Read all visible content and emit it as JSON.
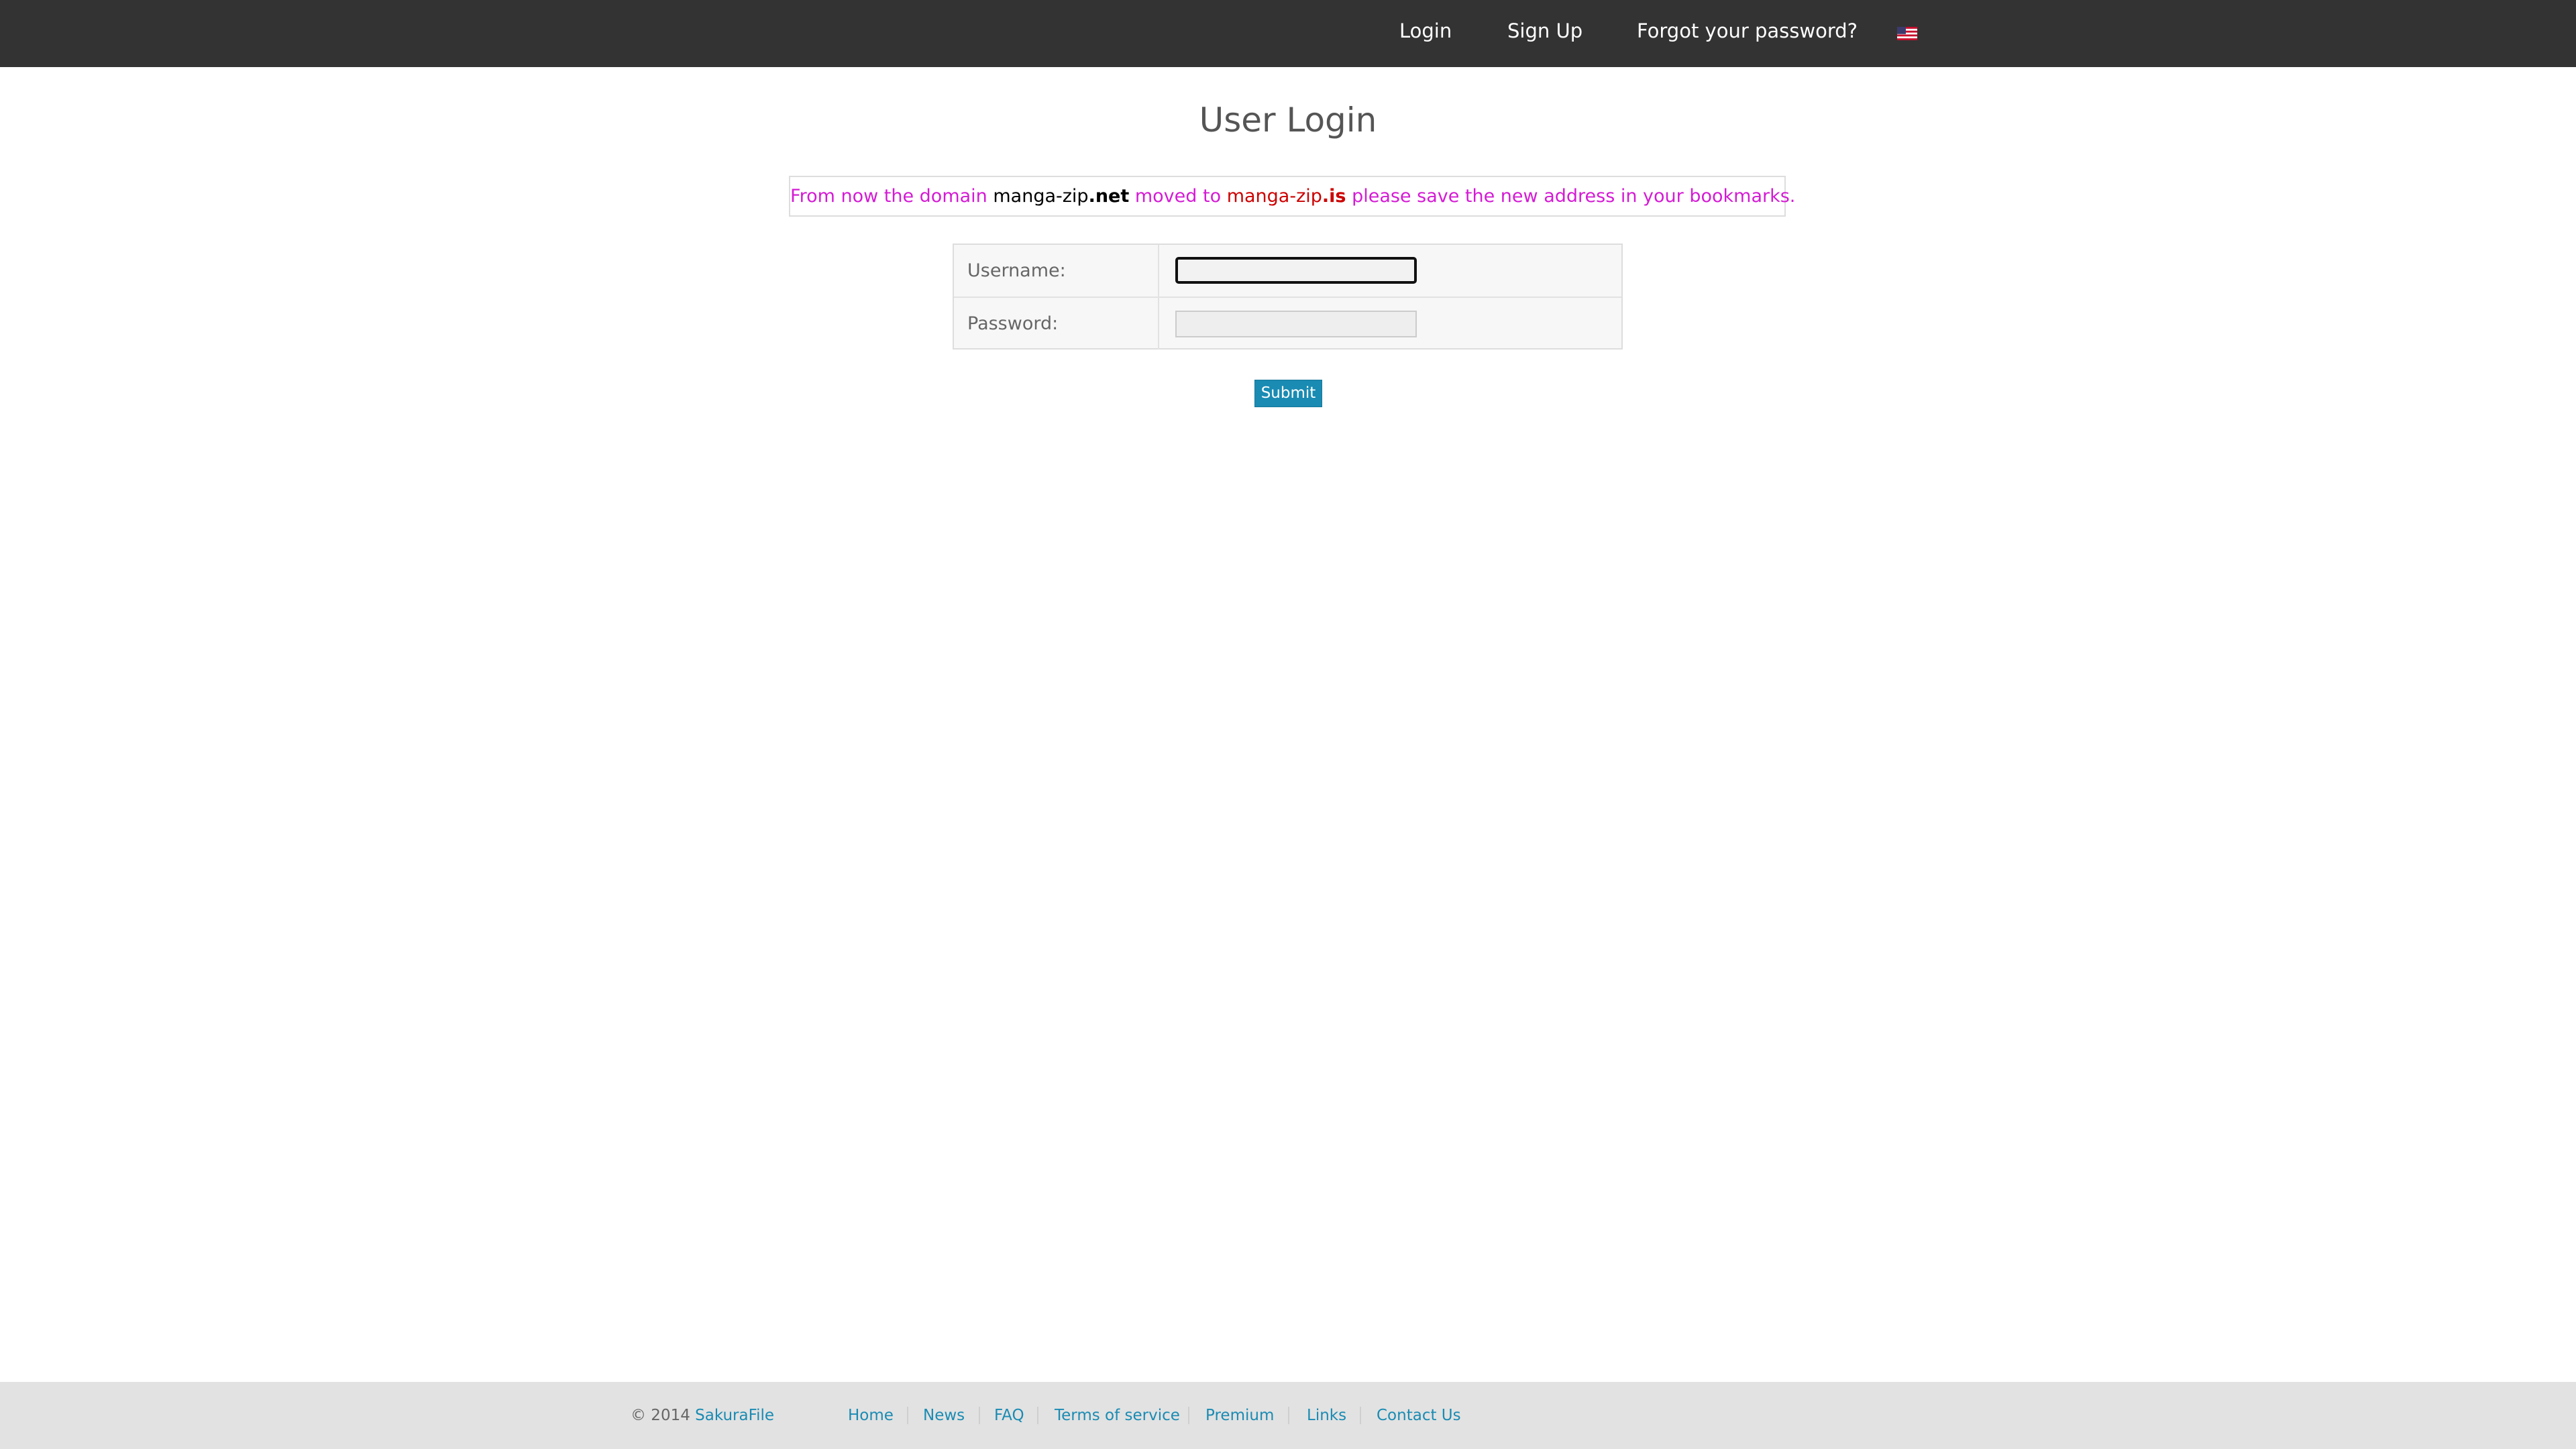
{
  "nav": {
    "login": "Login",
    "signup": "Sign Up",
    "forgot": "Forgot your password?",
    "language_icon": "us-flag-icon"
  },
  "page": {
    "title": "User Login"
  },
  "notice": {
    "part1": "From now the domain ",
    "old_domain_name": "manga-zip",
    "old_domain_tld": ".net",
    "part2": " moved to ",
    "new_domain_name": "manga-zip",
    "new_domain_tld": ".is",
    "part3": " please save the new address in your bookmarks."
  },
  "form": {
    "username_label": "Username:",
    "username_value": "",
    "password_label": "Password:",
    "password_value": "",
    "submit_label": "Submit"
  },
  "footer": {
    "copyright": "© 2014 ",
    "brand": "SakuraFile",
    "links": [
      "Home",
      "News",
      "FAQ",
      "Terms of service",
      "Premium",
      "Links",
      "Contact Us"
    ]
  },
  "colors": {
    "topbar": "#333333",
    "notice_text": "#d41bd4",
    "notice_new_domain": "#cc0000",
    "accent": "#1a8bb3",
    "footer_bg": "#e2e2e2"
  }
}
